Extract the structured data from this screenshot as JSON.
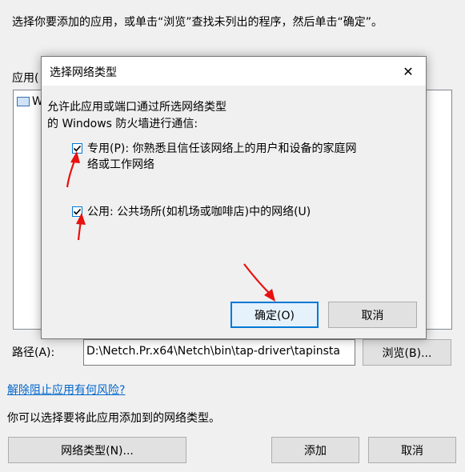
{
  "main": {
    "instruction": "选择你要添加的应用，或单击“浏览”查找未列出的程序，然后单击“确定”。",
    "apps_label": "应用(",
    "app_item_text": "W",
    "path_label": "路径(A):",
    "path_value": "D:\\Netch.Pr.x64\\Netch\\bin\\tap-driver\\tapinsta",
    "browse_button": "浏览(B)...",
    "risk_link": "解除阻止应用有何风险?",
    "network_type_hint": "你可以选择要将此应用添加到的网络类型。",
    "network_type_button": "网络类型(N)...",
    "add_button": "添加",
    "cancel_button": "取消"
  },
  "dialog": {
    "title": "选择网络类型",
    "close_glyph": "✕",
    "description_line1": "允许此应用或端口通过所选网络类型",
    "description_line2": "的 Windows 防火墙进行通信:",
    "private_label_line1": "专用(P): 你熟悉且信任该网络上的用户和设备的家庭网",
    "private_label_line2": "络或工作网络",
    "private_checked": true,
    "public_label": "公用: 公共场所(如机场或咖啡店)中的网络(U)",
    "public_checked": true,
    "ok_button": "确定(O)",
    "cancel_button": "取消"
  },
  "colors": {
    "accent": "#0078d7",
    "link": "#0066cc",
    "annotation_arrow": "#e81010"
  },
  "icons": [
    "close-icon",
    "checkmark-icon",
    "app-icon",
    "annotation-arrow"
  ]
}
